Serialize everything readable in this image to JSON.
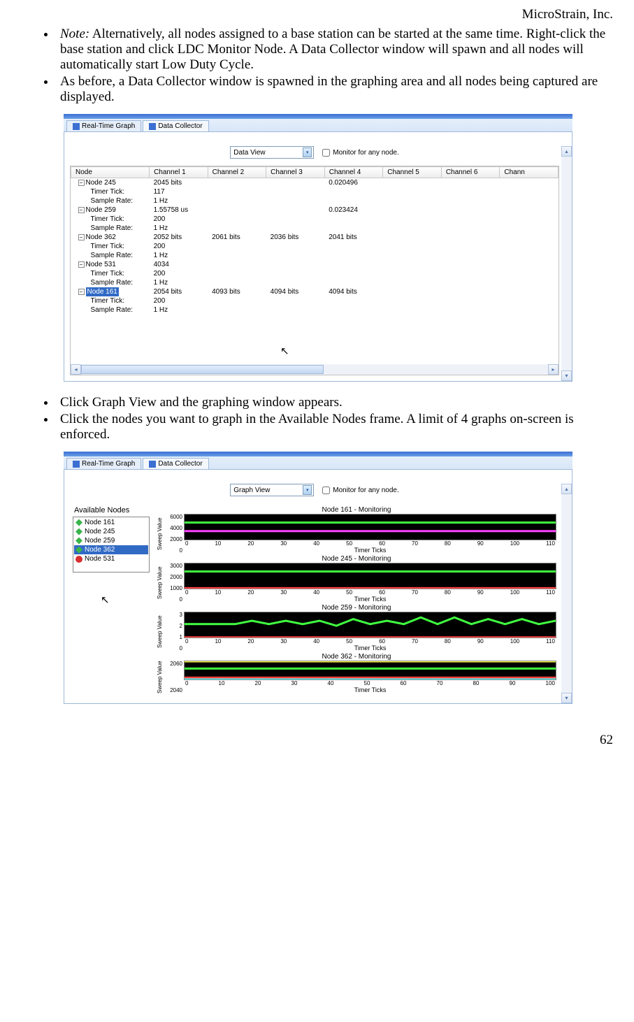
{
  "header": {
    "company": "MicroStrain, Inc."
  },
  "bullets_top": [
    {
      "note_prefix": "Note:",
      "text": " Alternatively, all nodes assigned to a base station can be started at the same time. Right-click the base station and click LDC Monitor Node.  A Data Collector window will spawn and all nodes will automatically start Low Duty Cycle."
    },
    {
      "text": "As before, a Data Collector window is spawned in the graphing area and all nodes being captured are displayed."
    }
  ],
  "bullets_mid": [
    {
      "text": "Click Graph View and the graphing window appears."
    },
    {
      "text": "Click the nodes you want to graph in the Available Nodes frame. A limit of 4 graphs on-screen is enforced."
    }
  ],
  "shot1": {
    "tabs": {
      "rt": "Real-Time Graph",
      "dc": "Data Collector"
    },
    "view_dd": "Data View",
    "monitor_label": "Monitor for any node.",
    "columns": [
      "Node",
      "Channel 1",
      "Channel 2",
      "Channel 3",
      "Channel 4",
      "Channel 5",
      "Channel 6",
      "Chann"
    ],
    "rows": [
      {
        "n": "Node 245",
        "c1": "2045 bits",
        "c4": "0.020496"
      },
      {
        "n2": "Timer Tick:",
        "c1": "117"
      },
      {
        "n2": "Sample Rate:",
        "c1": "1 Hz"
      },
      {
        "n": "Node 259",
        "c1": "1.55758 us",
        "c4": "0.023424"
      },
      {
        "n2": "Timer Tick:",
        "c1": "200"
      },
      {
        "n2": "Sample Rate:",
        "c1": "1 Hz"
      },
      {
        "n": "Node 362",
        "c1": "2052 bits",
        "c2": "2061 bits",
        "c3": "2036 bits",
        "c4": "2041 bits"
      },
      {
        "n2": "Timer Tick:",
        "c1": "200"
      },
      {
        "n2": "Sample Rate:",
        "c1": "1 Hz"
      },
      {
        "n": "Node 531",
        "c1": "4034"
      },
      {
        "n2": "Timer Tick:",
        "c1": "200"
      },
      {
        "n2": "Sample Rate:",
        "c1": "1 Hz"
      },
      {
        "nsel": "Node 161",
        "c1": "2054 bits",
        "c2": "4093 bits",
        "c3": "4094 bits",
        "c4": "4094 bits"
      },
      {
        "n2": "Timer Tick:",
        "c1": "200"
      },
      {
        "n2": "Sample Rate:",
        "c1": "1 Hz"
      }
    ]
  },
  "shot2": {
    "tabs": {
      "rt": "Real-Time Graph",
      "dc": "Data Collector"
    },
    "view_dd": "Graph View",
    "monitor_label": "Monitor for any node.",
    "avail_title": "Available Nodes",
    "avail": [
      {
        "label": "Node 161",
        "kind": "g"
      },
      {
        "label": "Node 245",
        "kind": "g"
      },
      {
        "label": "Node 259",
        "kind": "g"
      },
      {
        "label": "Node 362",
        "kind": "g",
        "sel": true
      },
      {
        "label": "Node 531",
        "kind": "r"
      }
    ],
    "charts": [
      {
        "title": "Node 161 - Monitoring",
        "ylab": "Sweep Value",
        "yticks": [
          "6000",
          "4000",
          "2000",
          "0"
        ],
        "xticks": [
          "0",
          "10",
          "20",
          "30",
          "40",
          "50",
          "60",
          "70",
          "80",
          "90",
          "100",
          "110"
        ],
        "xlab": "Timer Ticks"
      },
      {
        "title": "Node 245 - Monitoring",
        "ylab": "Sweep Value",
        "yticks": [
          "3000",
          "2000",
          "1000",
          "0"
        ],
        "xticks": [
          "0",
          "10",
          "20",
          "30",
          "40",
          "50",
          "60",
          "70",
          "80",
          "90",
          "100",
          "110"
        ],
        "xlab": "Timer Ticks"
      },
      {
        "title": "Node 259 - Monitoring",
        "ylab": "Sweep Value",
        "yticks": [
          "3",
          "2",
          "1",
          "0"
        ],
        "xticks": [
          "0",
          "10",
          "20",
          "30",
          "40",
          "50",
          "60",
          "70",
          "80",
          "90",
          "100",
          "110"
        ],
        "xlab": "Timer Ticks"
      },
      {
        "title": "Node 362 - Monitoring",
        "ylab": "Sweep Value",
        "yticks": [
          "2060",
          "2040"
        ],
        "xticks": [
          "0",
          "10",
          "20",
          "30",
          "40",
          "50",
          "60",
          "70",
          "80",
          "90",
          "100"
        ],
        "xlab": "Timer Ticks"
      }
    ]
  },
  "chart_data": [
    {
      "type": "line",
      "title": "Node 161 - Monitoring",
      "xlabel": "Timer Ticks",
      "ylabel": "Sweep Value",
      "xlim": [
        0,
        110
      ],
      "ylim": [
        0,
        6000
      ],
      "series": [
        {
          "name": "ch-magenta",
          "color": "#ff40ff",
          "x": [
            0,
            110
          ],
          "y": [
            2050,
            2050
          ]
        },
        {
          "name": "ch-yellow",
          "color": "#ffff40",
          "x": [
            0,
            110
          ],
          "y": [
            4090,
            4090
          ]
        },
        {
          "name": "ch-cyan",
          "color": "#40ffff",
          "x": [
            0,
            110
          ],
          "y": [
            4090,
            4090
          ]
        },
        {
          "name": "ch-green",
          "color": "#40ff40",
          "x": [
            0,
            110
          ],
          "y": [
            4090,
            4090
          ]
        }
      ]
    },
    {
      "type": "line",
      "title": "Node 245 - Monitoring",
      "xlabel": "Timer Ticks",
      "ylabel": "Sweep Value",
      "xlim": [
        0,
        110
      ],
      "ylim": [
        0,
        3000
      ],
      "series": [
        {
          "name": "ch-green",
          "color": "#40ff40",
          "x": [
            0,
            110
          ],
          "y": [
            2045,
            2045
          ]
        },
        {
          "name": "ch-red",
          "color": "#ff4040",
          "x": [
            0,
            110
          ],
          "y": [
            50,
            50
          ]
        }
      ]
    },
    {
      "type": "line",
      "title": "Node 259 - Monitoring",
      "xlabel": "Timer Ticks",
      "ylabel": "Sweep Value",
      "xlim": [
        0,
        110
      ],
      "ylim": [
        0,
        3
      ],
      "series": [
        {
          "name": "ch-green",
          "color": "#40ff40",
          "x": [
            0,
            5,
            10,
            15,
            20,
            25,
            30,
            35,
            40,
            45,
            50,
            55,
            60,
            65,
            70,
            75,
            80,
            85,
            90,
            95,
            100,
            105,
            110
          ],
          "y": [
            1.6,
            1.6,
            1.6,
            1.6,
            2.0,
            1.6,
            2.0,
            1.6,
            2.0,
            1.4,
            2.2,
            1.6,
            2.0,
            1.6,
            2.4,
            1.6,
            2.4,
            1.6,
            2.2,
            1.6,
            2.2,
            1.6,
            2.0
          ]
        },
        {
          "name": "ch-red",
          "color": "#ff4040",
          "x": [
            0,
            110
          ],
          "y": [
            0.02,
            0.02
          ]
        }
      ]
    },
    {
      "type": "line",
      "title": "Node 362 - Monitoring",
      "xlabel": "Timer Ticks",
      "ylabel": "Sweep Value",
      "xlim": [
        0,
        100
      ],
      "ylim": [
        2040,
        2060
      ],
      "series": [
        {
          "name": "ch-green",
          "color": "#40ff40",
          "x": [
            0,
            100
          ],
          "y": [
            2052,
            2052
          ]
        },
        {
          "name": "ch-yellow",
          "color": "#ffff40",
          "x": [
            0,
            100
          ],
          "y": [
            2060,
            2060
          ]
        },
        {
          "name": "ch-red",
          "color": "#ff4040",
          "x": [
            0,
            100
          ],
          "y": [
            2042,
            2042
          ]
        },
        {
          "name": "ch-cyan",
          "color": "#40ffff",
          "x": [
            0,
            100
          ],
          "y": [
            2040,
            2040
          ]
        }
      ]
    }
  ],
  "footer": {
    "page": "62"
  }
}
